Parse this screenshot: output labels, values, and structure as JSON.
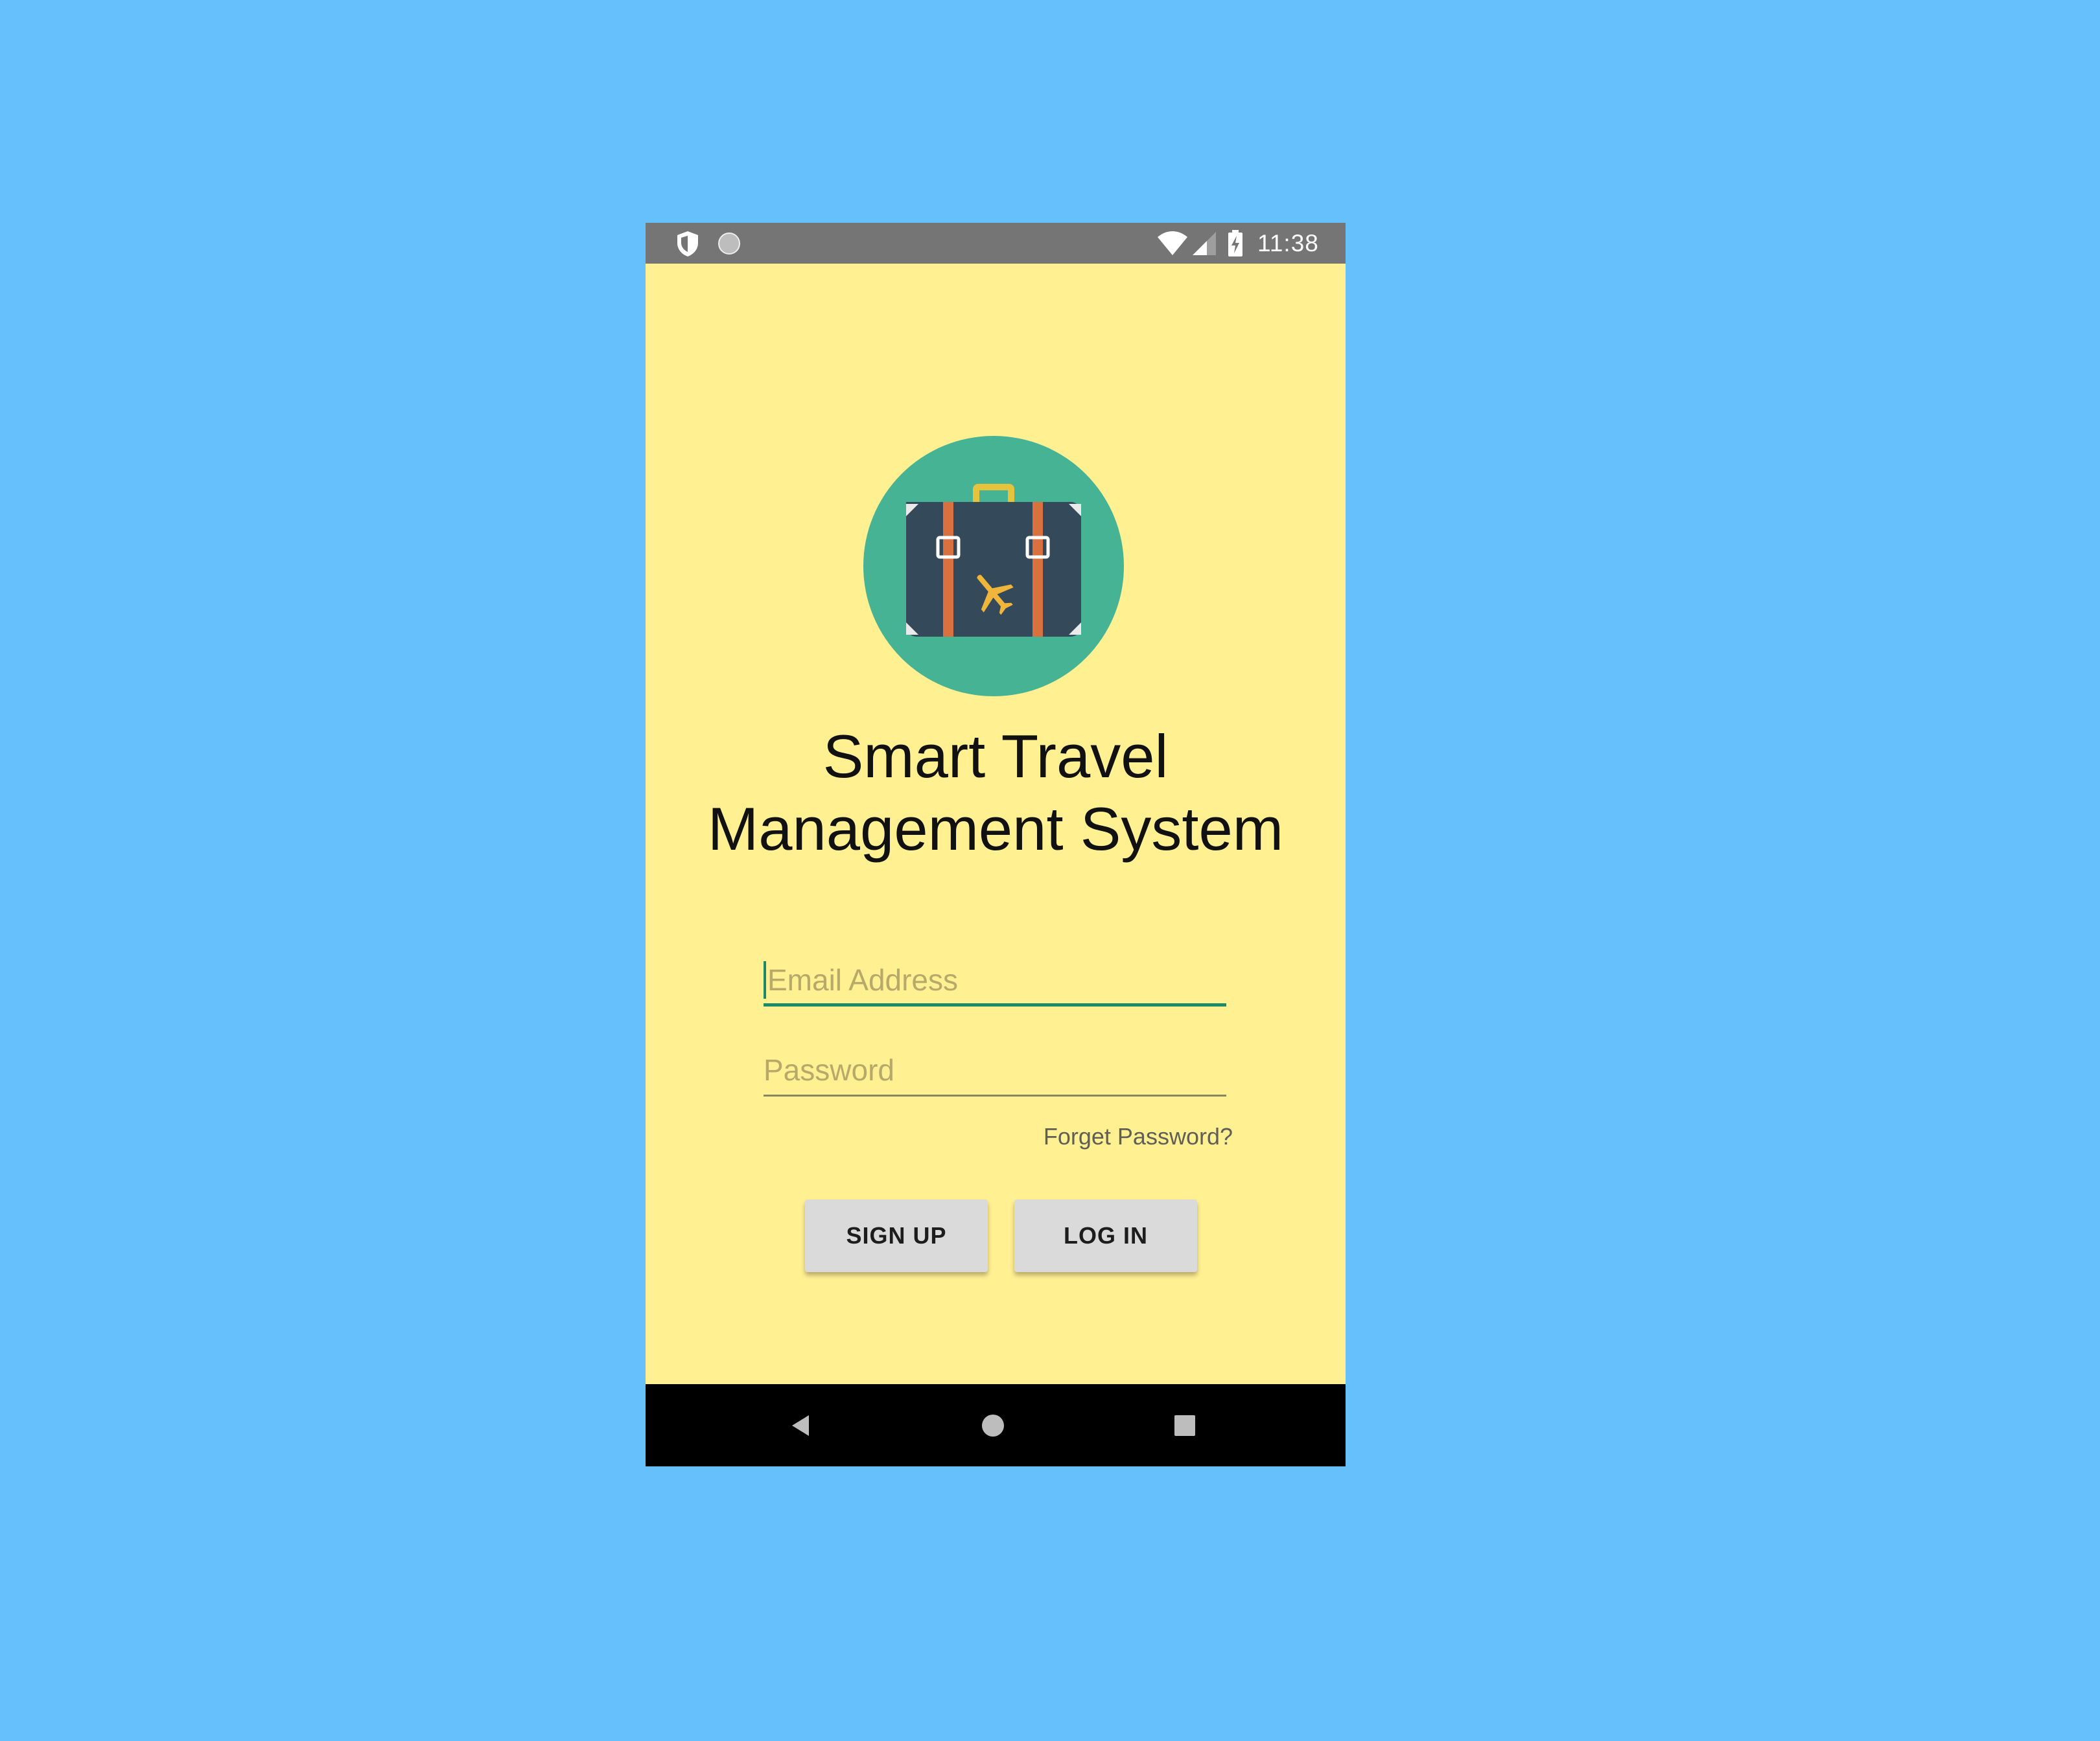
{
  "status_bar": {
    "time": "11:38",
    "icons": [
      "shield-icon",
      "circle-notification-icon",
      "wifi-icon",
      "signal-icon",
      "battery-charging-icon"
    ]
  },
  "app": {
    "logo_icon": "suitcase-airplane-icon",
    "title_line1": "Smart Travel",
    "title_line2": "Management System"
  },
  "form": {
    "email_placeholder": "Email Address",
    "password_placeholder": "Password",
    "forgot_label": "Forget Password?"
  },
  "buttons": {
    "signup_label": "SIGN UP",
    "login_label": "LOG IN"
  },
  "nav_bar": {
    "icons": [
      "back-icon",
      "home-icon",
      "recents-icon"
    ]
  },
  "colors": {
    "background": "#66c0fb",
    "screen": "#fff092",
    "status_bar": "#757575",
    "accent": "#1a8a6a",
    "logo_circle": "#45b394"
  }
}
